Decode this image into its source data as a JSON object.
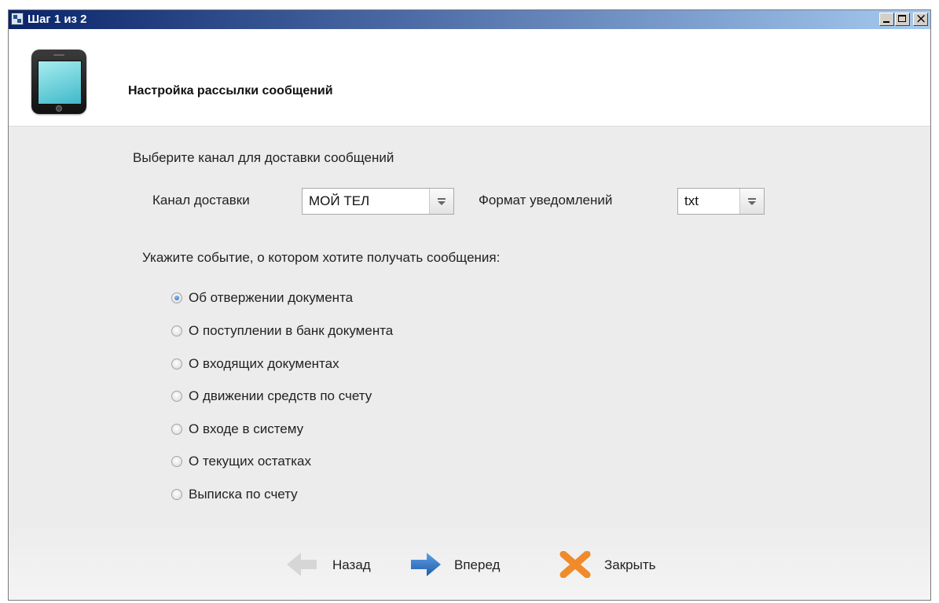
{
  "window": {
    "title": "Шаг 1 из 2"
  },
  "header": {
    "title": "Настройка рассылки сообщений"
  },
  "channel_section": {
    "prompt": "Выберите канал для доставки сообщений",
    "channel_label": "Канал доставки",
    "channel_value": "МОЙ ТЕЛ",
    "format_label": "Формат уведомлений",
    "format_value": "txt"
  },
  "event_section": {
    "prompt": "Укажите событие, о котором хотите получать сообщения:",
    "options": [
      {
        "label": "Об отвержении документа",
        "checked": true
      },
      {
        "label": "О поступлении в банк документа",
        "checked": false
      },
      {
        "label": "О входящих документах",
        "checked": false
      },
      {
        "label": "О движении средств по счету",
        "checked": false
      },
      {
        "label": "О входе в систему",
        "checked": false
      },
      {
        "label": "О текущих остатках",
        "checked": false
      },
      {
        "label": "Выписка по счету",
        "checked": false
      }
    ]
  },
  "footer": {
    "back_label": "Назад",
    "forward_label": "Вперед",
    "close_label": "Закрыть"
  },
  "icons": {
    "window_icon": "app-icon",
    "header_icon": "phone-icon",
    "back": "arrow-left-icon",
    "forward": "arrow-right-icon",
    "close": "close-x-icon"
  },
  "colors": {
    "titlebar_start": "#0a246a",
    "titlebar_end": "#a6caf0",
    "forward_arrow": "#2f6fbf",
    "close_x": "#f08a2a",
    "back_arrow_disabled": "#d6d6d6"
  }
}
